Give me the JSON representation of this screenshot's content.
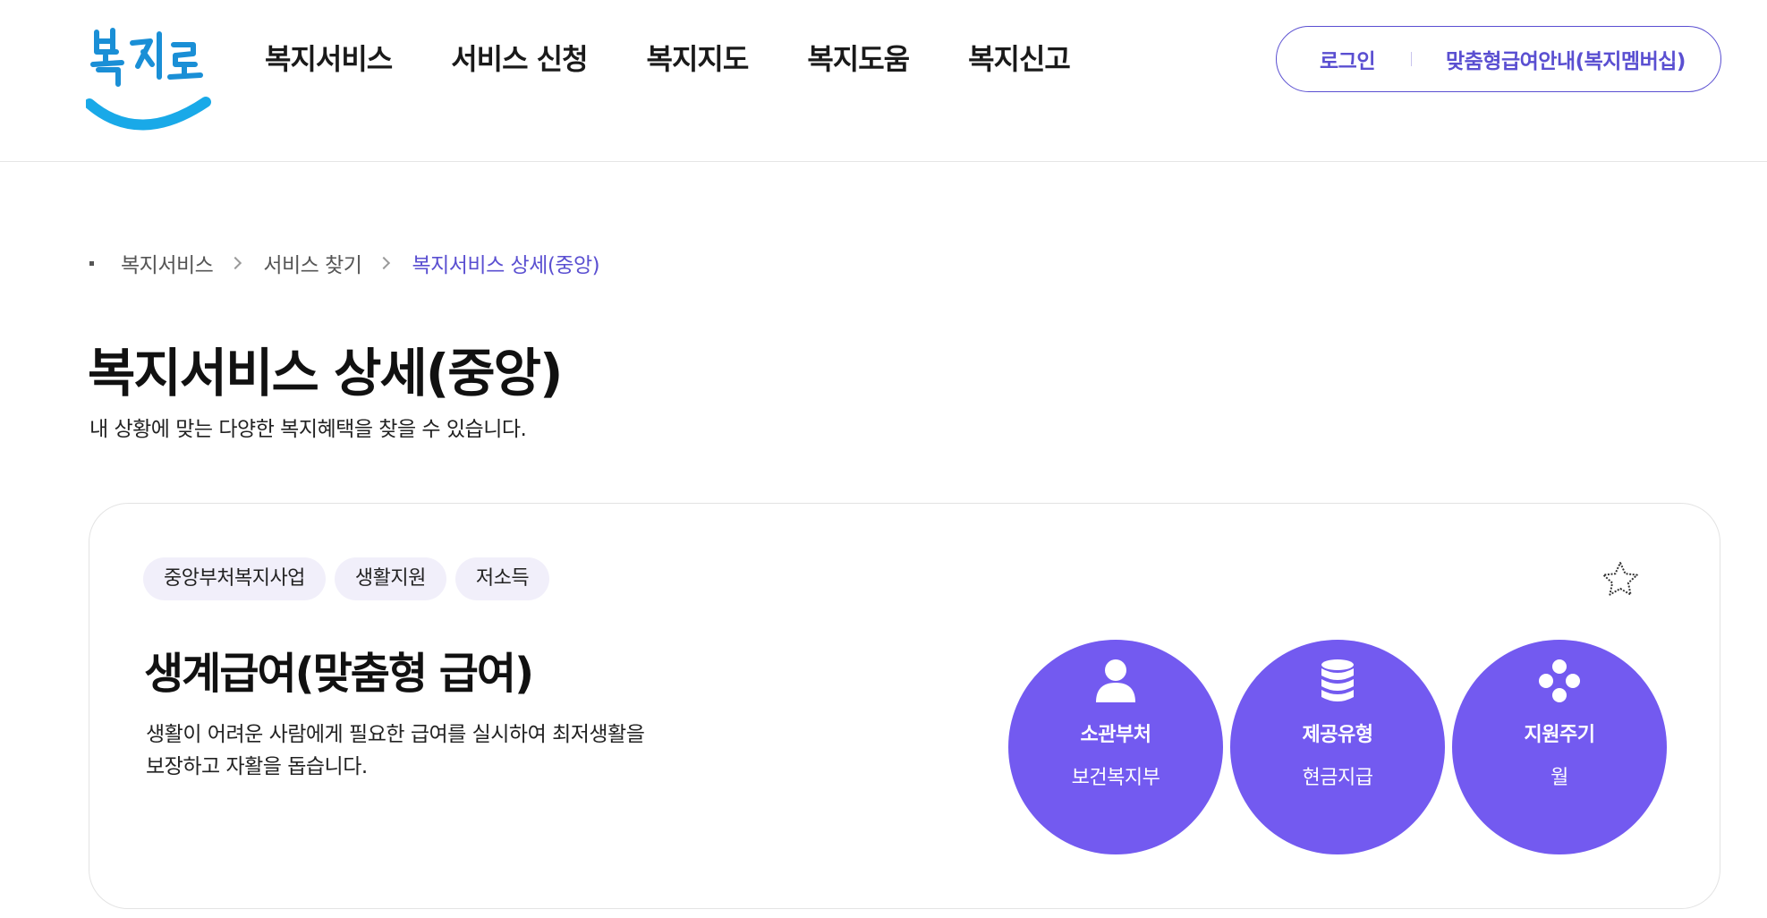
{
  "header": {
    "logo_text": "복지로",
    "nav": [
      {
        "label": "복지서비스"
      },
      {
        "label": "서비스 신청"
      },
      {
        "label": "복지지도"
      },
      {
        "label": "복지도움"
      },
      {
        "label": "복지신고"
      }
    ],
    "util": {
      "login": "로그인",
      "membership": "맞춤형급여안내(복지멤버십)"
    }
  },
  "breadcrumb": [
    "복지서비스",
    "서비스 찾기",
    "복지서비스 상세(중앙)"
  ],
  "page": {
    "title": "복지서비스 상세(중앙)",
    "description": "내 상황에 맞는 다양한 복지혜택을 찾을 수 있습니다."
  },
  "service": {
    "tags": [
      "중앙부처복지사업",
      "생활지원",
      "저소득"
    ],
    "title": "생계급여(맞춤형 급여)",
    "description": "생활이 어려운 사람에게 필요한 급여를 실시하여 최저생활을 보장하고 자활을 돕습니다.",
    "favorite_icon": "star-outline-icon",
    "info": [
      {
        "icon": "person-icon",
        "label": "소관부처",
        "value": "보건복지부"
      },
      {
        "icon": "database-icon",
        "label": "제공유형",
        "value": "현금지급"
      },
      {
        "icon": "dots-cluster-icon",
        "label": "지원주기",
        "value": "월"
      }
    ]
  },
  "colors": {
    "accent": "#5a4fd1",
    "circle": "#735af0",
    "tag_bg": "#f1effa",
    "logo_smile": "#19a9e8",
    "logo_text": "#1a8fd6"
  }
}
